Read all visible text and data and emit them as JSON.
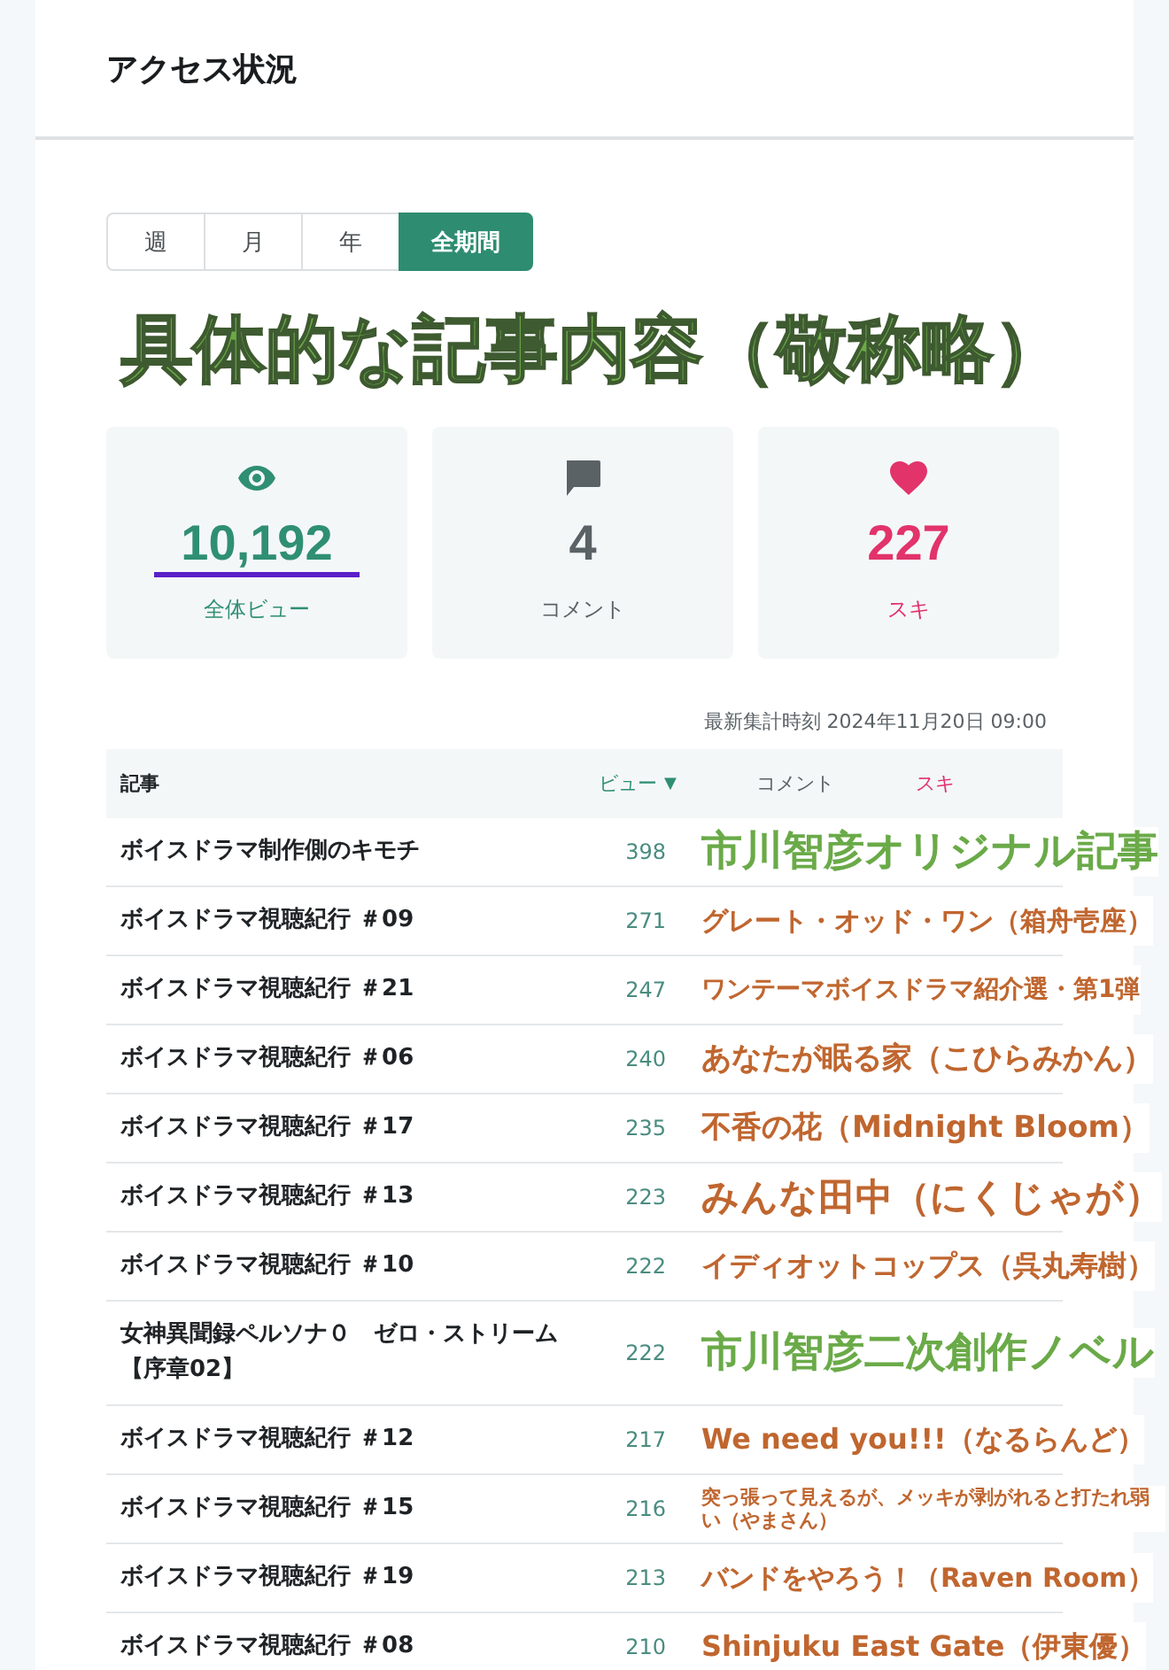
{
  "header": {
    "title": "アクセス状況"
  },
  "period_tabs": [
    {
      "label": "週",
      "selected": false
    },
    {
      "label": "月",
      "selected": false
    },
    {
      "label": "年",
      "selected": false
    },
    {
      "label": "全期間",
      "selected": true
    }
  ],
  "heading_annotation": {
    "text": "具体的な記事内容（敬称略）",
    "color": "#6aaa48"
  },
  "stats": [
    {
      "kind": "views",
      "value": "10,192",
      "label": "全体ビュー",
      "underlined": true
    },
    {
      "kind": "comments",
      "value": "4",
      "label": "コメント",
      "underlined": false
    },
    {
      "kind": "likes",
      "value": "227",
      "label": "スキ",
      "underlined": false
    }
  ],
  "updated_at": "最新集計時刻 2024年11月20日 09:00",
  "table": {
    "columns": [
      {
        "kind": "article",
        "label": "記事"
      },
      {
        "kind": "views",
        "label": "ビュー",
        "sort": "▼"
      },
      {
        "kind": "comments",
        "label": "コメント"
      },
      {
        "kind": "likes",
        "label": "スキ"
      }
    ],
    "rows": [
      {
        "title": "ボイスドラマ制作側のキモチ",
        "views": "398",
        "annotation": "市川智彦オリジナル記事",
        "color": "#6aaa48"
      },
      {
        "title": "ボイスドラマ視聴紀行 ＃09",
        "views": "271",
        "annotation": "グレート・オッド・ワン（箱舟壱座）",
        "color": "#c0662f"
      },
      {
        "title": "ボイスドラマ視聴紀行 ＃21",
        "views": "247",
        "annotation": "ワンテーマボイスドラマ紹介選・第1弾",
        "color": "#c0662f"
      },
      {
        "title": "ボイスドラマ視聴紀行 ＃06",
        "views": "240",
        "annotation": "あなたが眠る家（こひらみかん）",
        "color": "#c0662f"
      },
      {
        "title": "ボイスドラマ視聴紀行 ＃17",
        "views": "235",
        "annotation": "不香の花（Midnight Bloom）",
        "color": "#c0662f"
      },
      {
        "title": "ボイスドラマ視聴紀行 ＃13",
        "views": "223",
        "annotation": "みんな田中（にくじゃが）",
        "color": "#c0662f"
      },
      {
        "title": "ボイスドラマ視聴紀行 ＃10",
        "views": "222",
        "annotation": "イディオットコップス（呉丸寿樹）",
        "color": "#c0662f"
      },
      {
        "title": "女神異聞録ペルソナ０　ゼロ・ストリーム【序章02】",
        "views": "222",
        "annotation": "市川智彦二次創作ノベル",
        "color": "#6aaa48"
      },
      {
        "title": "ボイスドラマ視聴紀行 ＃12",
        "views": "217",
        "annotation": "We need you!!!（なるらんど）",
        "color": "#c0662f"
      },
      {
        "title": "ボイスドラマ視聴紀行 ＃15",
        "views": "216",
        "annotation": "突っ張って見えるが、メッキが剥がれると打たれ弱い（やまさん）",
        "color": "#c0662f"
      },
      {
        "title": "ボイスドラマ視聴紀行 ＃19",
        "views": "213",
        "annotation": "バンドをやろう！（Raven Room）",
        "color": "#c0662f"
      },
      {
        "title": "ボイスドラマ視聴紀行 ＃08",
        "views": "210",
        "annotation": "Shinjuku East Gate（伊東優）",
        "color": "#c0662f"
      }
    ]
  }
}
